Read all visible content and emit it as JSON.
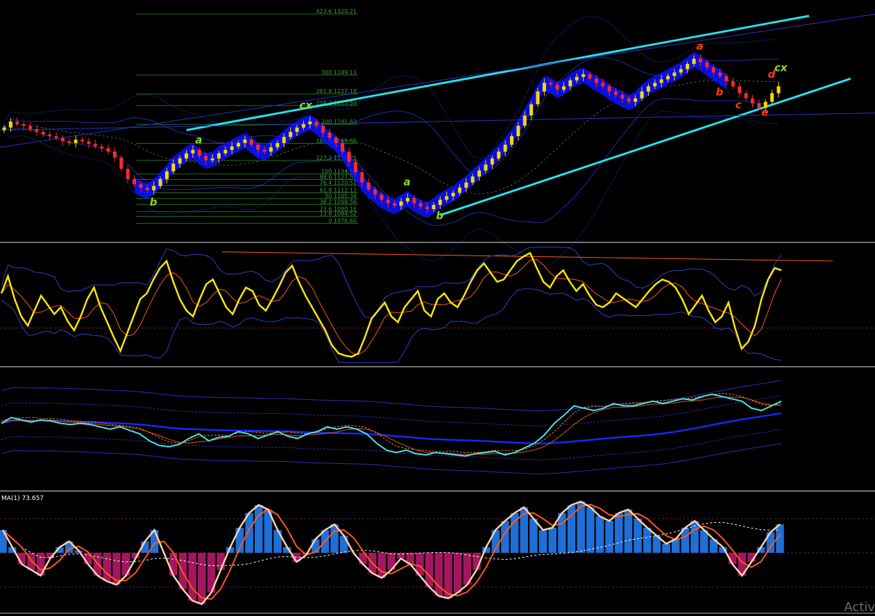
{
  "chart_data": [
    {
      "pane": "price",
      "type": "candlestick",
      "closes": [
        1188,
        1195,
        1192,
        1190,
        1186,
        1183,
        1180,
        1178,
        1176,
        1172,
        1170,
        1174,
        1172,
        1169,
        1166,
        1164,
        1160,
        1153,
        1140,
        1128,
        1122,
        1118,
        1115,
        1120,
        1128,
        1137,
        1146,
        1152,
        1158,
        1162,
        1155,
        1150,
        1152,
        1158,
        1162,
        1166,
        1170,
        1174,
        1168,
        1162,
        1160,
        1165,
        1170,
        1177,
        1183,
        1188,
        1192,
        1195,
        1190,
        1182,
        1176,
        1170,
        1160,
        1148,
        1136,
        1124,
        1116,
        1110,
        1104,
        1100,
        1097,
        1102,
        1106,
        1100,
        1096,
        1093,
        1098,
        1104,
        1108,
        1112,
        1118,
        1124,
        1131,
        1138,
        1145,
        1152,
        1160,
        1168,
        1178,
        1190,
        1202,
        1215,
        1230,
        1240,
        1238,
        1232,
        1236,
        1243,
        1247,
        1250,
        1245,
        1240,
        1236,
        1230,
        1226,
        1222,
        1218,
        1222,
        1230,
        1236,
        1240,
        1244,
        1248,
        1252,
        1256,
        1262,
        1268,
        1264,
        1258,
        1252,
        1248,
        1242,
        1236,
        1228,
        1222,
        1216,
        1211,
        1218,
        1228,
        1236
      ],
      "fib_levels": [
        {
          "label": "423.6 1320.21"
        },
        {
          "label": "300 1249.13"
        },
        {
          "label": "261.8 1227.18"
        },
        {
          "label": "238.2 1213.59"
        },
        {
          "label": "200 1191.62"
        },
        {
          "label": "161.8 1169.65"
        },
        {
          "label": "127.2 1149.75"
        },
        {
          "label": "100 1134.10"
        },
        {
          "label": "88.6 1127.55"
        },
        {
          "label": "76.4 1120.51"
        },
        {
          "label": "61.8 1112.12"
        },
        {
          "label": "50 1105.34"
        },
        {
          "label": "38.2 1098.56"
        },
        {
          "label": "23.6 1090.16"
        },
        {
          "label": "13.8 1084.52"
        },
        {
          "label": "0 1076.60"
        }
      ],
      "wave_labels": [
        {
          "text": "a",
          "color": "#8ed42a",
          "idx": 30
        },
        {
          "text": "b",
          "color": "#8ed42a",
          "idx": 23
        },
        {
          "text": "cx",
          "color": "#8ed42a",
          "idx": 46
        },
        {
          "text": "a",
          "color": "#8ed42a",
          "idx": 62
        },
        {
          "text": "b",
          "color": "#8ed42a",
          "idx": 67
        },
        {
          "text": "cx",
          "color": "#8ed42a",
          "idx": 120
        },
        {
          "text": "b",
          "color": "#ff3a10",
          "idx": 110
        },
        {
          "text": "d",
          "color": "#ff3a10",
          "idx": 118
        },
        {
          "text": "a",
          "color": "#ff3a10",
          "idx": 107
        },
        {
          "text": "c",
          "color": "#ff3a10",
          "idx": 113
        },
        {
          "text": "e",
          "color": "#ff3a10",
          "idx": 117
        }
      ],
      "colors": {
        "bull": "#ffd700",
        "bear": "#ff2a2a",
        "channel": "#22e3ee",
        "band": "#1c2da8",
        "ribbon": "#0a12ff"
      }
    },
    {
      "pane": "oscillator",
      "type": "line",
      "values": [
        60,
        75,
        55,
        40,
        32,
        45,
        58,
        50,
        42,
        48,
        36,
        28,
        40,
        55,
        65,
        48,
        35,
        22,
        10,
        25,
        40,
        55,
        60,
        72,
        82,
        88,
        70,
        55,
        45,
        40,
        55,
        68,
        72,
        60,
        48,
        42,
        55,
        65,
        62,
        50,
        45,
        55,
        66,
        78,
        84,
        70,
        58,
        48,
        38,
        28,
        15,
        8,
        6,
        5,
        8,
        22,
        38,
        45,
        52,
        40,
        35,
        48,
        55,
        62,
        45,
        40,
        55,
        60,
        52,
        48,
        58,
        70,
        80,
        86,
        78,
        70,
        72,
        80,
        88,
        92,
        95,
        82,
        70,
        65,
        75,
        80,
        70,
        62,
        68,
        58,
        50,
        48,
        52,
        60,
        56,
        52,
        48,
        55,
        62,
        68,
        72,
        70,
        65,
        55,
        42,
        50,
        58,
        45,
        35,
        40,
        52,
        30,
        12,
        18,
        32,
        55,
        72,
        82,
        80
      ]
    },
    {
      "pane": "rsi_bands",
      "type": "line",
      "values": [
        55,
        60,
        58,
        56,
        58,
        57,
        55,
        54,
        55,
        54,
        52,
        50,
        52,
        49,
        46,
        40,
        36,
        35,
        37,
        42,
        46,
        40,
        43,
        44,
        48,
        46,
        42,
        45,
        48,
        44,
        42,
        46,
        48,
        52,
        50,
        52,
        50,
        46,
        38,
        32,
        30,
        32,
        29,
        28,
        30,
        29,
        28,
        27,
        29,
        30,
        31,
        28,
        30,
        34,
        38,
        45,
        55,
        62,
        70,
        68,
        66,
        68,
        72,
        70,
        70,
        72,
        74,
        72,
        74,
        76,
        75,
        78,
        80,
        78,
        76,
        74,
        68,
        66,
        70,
        74
      ]
    },
    {
      "pane": "stochastic_histogram",
      "type": "bar",
      "label": "MA(1) 73.657",
      "values": [
        70,
        55,
        40,
        35,
        30,
        45,
        55,
        60,
        52,
        40,
        30,
        25,
        22,
        30,
        45,
        60,
        70,
        50,
        30,
        18,
        8,
        5,
        15,
        35,
        55,
        72,
        85,
        92,
        88,
        70,
        55,
        42,
        48,
        62,
        70,
        75,
        65,
        50,
        40,
        32,
        28,
        35,
        45,
        40,
        30,
        20,
        12,
        10,
        15,
        22,
        35,
        55,
        70,
        78,
        85,
        90,
        80,
        70,
        72,
        85,
        92,
        95,
        90,
        82,
        78,
        85,
        88,
        80,
        72,
        65,
        58,
        62,
        72,
        78,
        70,
        62,
        55,
        40,
        30,
        42,
        55,
        68,
        75
      ],
      "colors": {
        "positive": "#1e6fd6",
        "negative": "#a3175f",
        "main": "#ffd3a8",
        "signal": "#ff5a1a",
        "slow": "#ffffff"
      }
    }
  ],
  "ui": {
    "watermark": "Activ"
  }
}
